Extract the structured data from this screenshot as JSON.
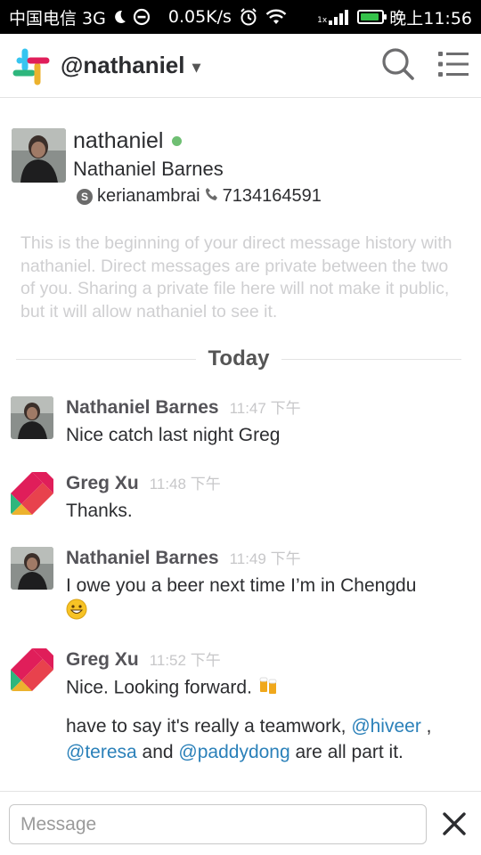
{
  "status_bar": {
    "carrier": "中国电信 3G",
    "speed": "0.05K/s",
    "network_small": "1x",
    "time": "晚上11:56",
    "battery_level": 0.9
  },
  "header": {
    "title": "@nathaniel",
    "icons": [
      "slack-logo-icon",
      "chevron-down-icon",
      "search-icon",
      "menu-icon"
    ]
  },
  "profile": {
    "username": "nathaniel",
    "full_name": "Nathaniel Barnes",
    "skype": "kerianambrai",
    "phone": "7134164591",
    "presence_color": "#6fbf73"
  },
  "intro_text": "This is the beginning of your direct message history with nathaniel. Direct messages are private between the two of you. Sharing a private file here will not make it public, but it will allow nathaniel to see it.",
  "divider_label": "Today",
  "messages": [
    {
      "author": "Nathaniel Barnes",
      "time": "11:47 下午",
      "text": "Nice catch last night Greg"
    },
    {
      "author": "Greg Xu",
      "time": "11:48 下午",
      "text": "Thanks."
    },
    {
      "author": "Nathaniel Barnes",
      "time": "11:49 下午",
      "text": "I owe you a beer next time I’m in Chengdu"
    },
    {
      "author": "Greg Xu",
      "time": "11:52 下午",
      "text": "Nice. Looking forward.",
      "text2_a": "have to say it's really a teamwork, ",
      "mention1": "@hiveer",
      "text2_b": " ,",
      "mention2": "@teresa",
      "text2_c": " and ",
      "mention3": "@paddydong",
      "text2_d": " are all part it."
    }
  ],
  "composer": {
    "placeholder": "Message"
  },
  "colors": {
    "mention": "#2a80b9",
    "presence": "#6fbf73",
    "slack_red": "#e01e5a",
    "slack_yellow": "#ecb22e",
    "slack_green": "#2eb67d",
    "slack_blue": "#36c5f0"
  }
}
